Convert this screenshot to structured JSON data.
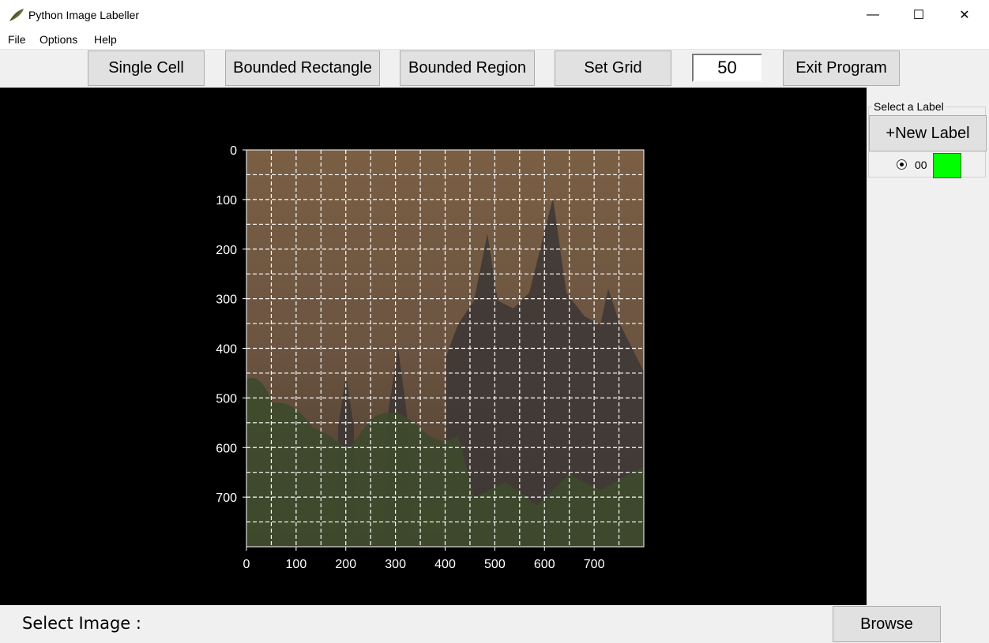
{
  "window": {
    "title": "Python Image Labeller",
    "minimize": "—",
    "maximize": "☐",
    "close": "✕"
  },
  "menu": {
    "file": "File",
    "options": "Options",
    "help": "Help"
  },
  "toolbar": {
    "single_cell": "Single Cell",
    "bounded_rectangle": "Bounded Rectangle",
    "bounded_region": "Bounded Region",
    "set_grid": "Set Grid",
    "grid_size": "50",
    "exit": "Exit Program"
  },
  "plot": {
    "x_ticks": [
      "0",
      "100",
      "200",
      "300",
      "400",
      "500",
      "600",
      "700"
    ],
    "y_ticks": [
      "0",
      "100",
      "200",
      "300",
      "400",
      "500",
      "600",
      "700"
    ],
    "image_extent": [
      0,
      800
    ],
    "grid_spacing": 50,
    "grid_style": "dashed white"
  },
  "labels_panel": {
    "title": "Select a Label",
    "new_label": "+New Label",
    "items": [
      {
        "name": "00",
        "color": "#00ff00",
        "selected": true
      }
    ]
  },
  "bottom": {
    "select_image": "Select Image :",
    "browse": "Browse"
  }
}
